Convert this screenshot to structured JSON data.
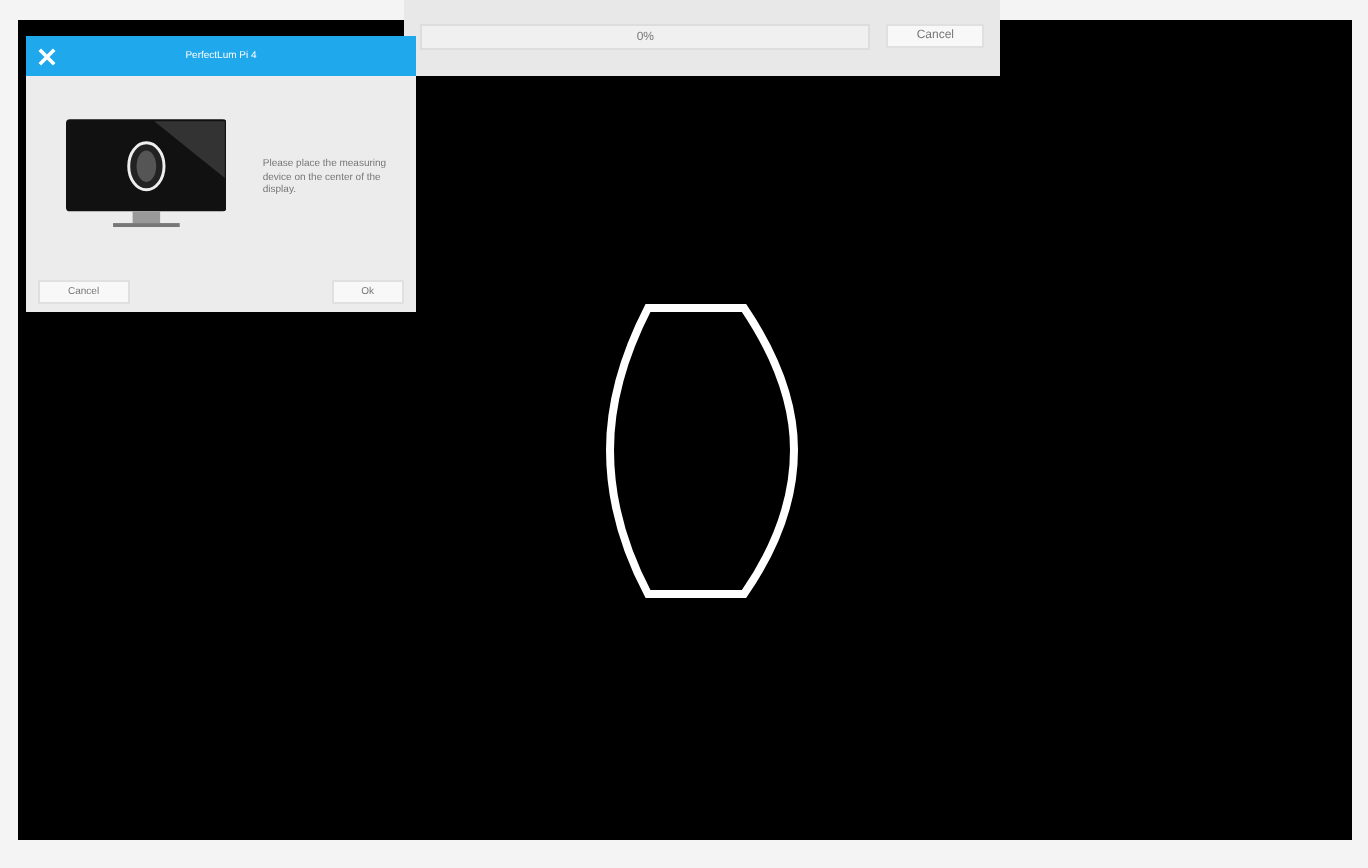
{
  "progress_window": {
    "progress": {
      "level": 0,
      "reading": "0%"
    },
    "buttons": [
      "Cancel"
    ]
  },
  "dialog": {
    "title": "PerfectLum Pi 4",
    "message": "Please place the measuring device on the center of the display.",
    "buttons": [
      "Cancel",
      "Ok"
    ]
  }
}
